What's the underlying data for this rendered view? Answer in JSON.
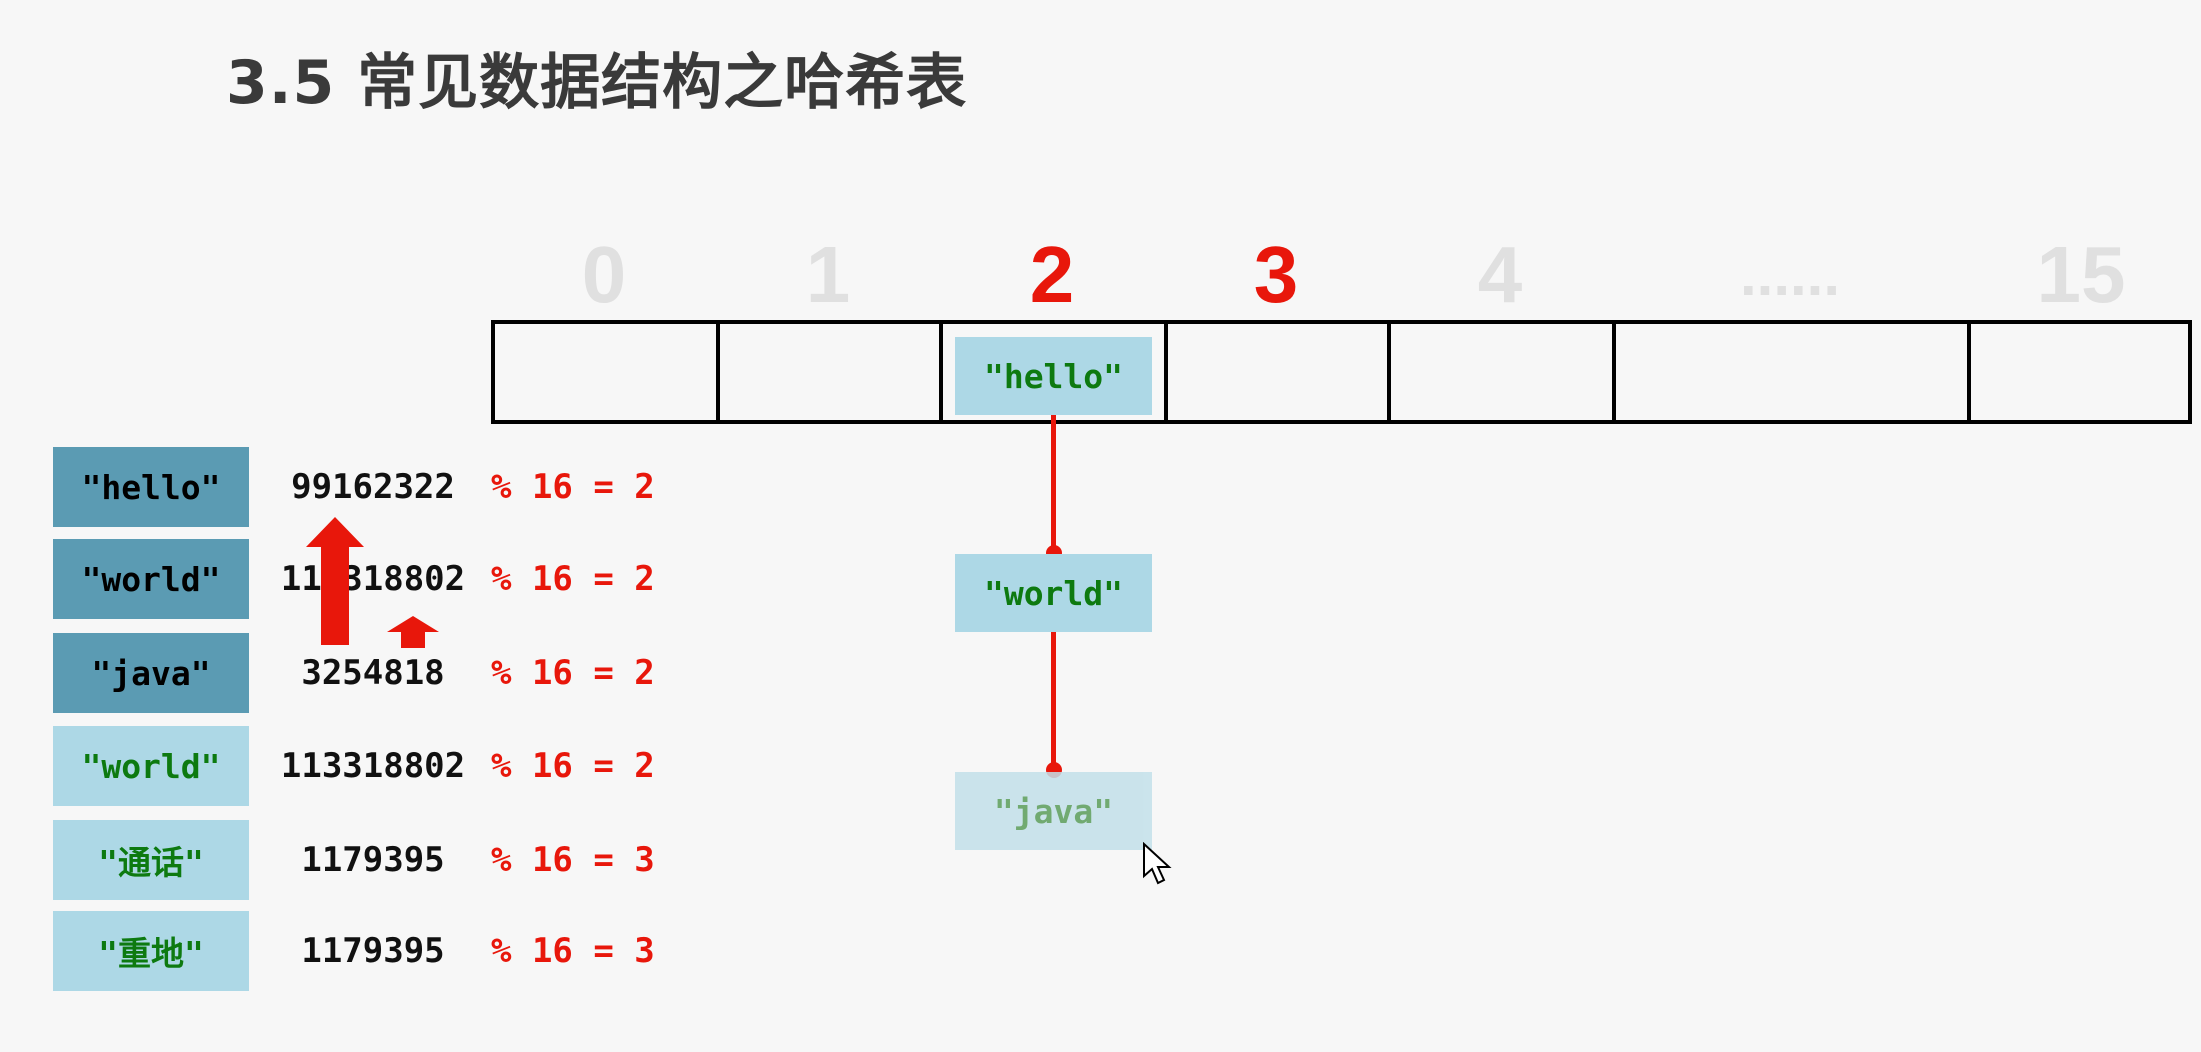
{
  "title": "3.5 常见数据结构之哈希表",
  "indices": [
    {
      "label": "0",
      "highlighted": false
    },
    {
      "label": "1",
      "highlighted": false
    },
    {
      "label": "2",
      "highlighted": true
    },
    {
      "label": "3",
      "highlighted": true
    },
    {
      "label": "4",
      "highlighted": false
    },
    {
      "label": "......",
      "highlighted": false
    },
    {
      "label": "15",
      "highlighted": false
    }
  ],
  "bucket_nodes": [
    "\"hello\"",
    "\"world\"",
    "\"java\""
  ],
  "rows": [
    {
      "key": "\"hello\"",
      "hash": "99162322",
      "mod": "% 16 = 2",
      "style": "dark"
    },
    {
      "key": "\"world\"",
      "hash": "113318802",
      "mod": "% 16 = 2",
      "style": "dark"
    },
    {
      "key": "\"java\"",
      "hash": "3254818",
      "mod": "% 16 = 2",
      "style": "dark"
    },
    {
      "key": "\"world\"",
      "hash": "113318802",
      "mod": "% 16 = 2",
      "style": "light"
    },
    {
      "key": "\"通话\"",
      "hash": "1179395",
      "mod": "% 16 = 3",
      "style": "light"
    },
    {
      "key": "\"重地\"",
      "hash": "1179395",
      "mod": "% 16 = 3",
      "style": "light"
    }
  ],
  "colors": {
    "accent": "#e8170b",
    "node_bg": "#add8e6",
    "key_dark_bg": "#5b9bb3",
    "text_green": "#0d7a10"
  },
  "icons": [
    "arrow-up-icon",
    "cursor-icon"
  ]
}
